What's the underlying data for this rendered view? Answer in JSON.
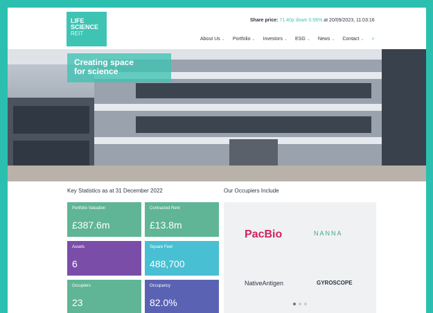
{
  "logo": {
    "line1": "LIFE",
    "line2": "SCIENCE",
    "line3": "REIT"
  },
  "header": {
    "share_label": "Share price:",
    "share_price": "71.40p down 0.56%",
    "share_time": "at 20/09/2023, 11:03:16",
    "nav": [
      {
        "label": "About Us"
      },
      {
        "label": "Portfolio"
      },
      {
        "label": "Investors"
      },
      {
        "label": "ESG"
      },
      {
        "label": "News"
      },
      {
        "label": "Contact"
      }
    ]
  },
  "hero": {
    "line1": "Creating space",
    "line2": "for science"
  },
  "stats": {
    "title": "Key Statistics as at 31 December 2022",
    "tiles": [
      {
        "label": "Portfolio Valuation",
        "value": "£387.6m",
        "color": "#5fb596"
      },
      {
        "label": "Contracted Rent",
        "value": "£13.8m",
        "color": "#5fb596"
      },
      {
        "label": "Assets",
        "value": "6",
        "color": "#7a4ea8"
      },
      {
        "label": "Square Feet",
        "value": "488,700",
        "color": "#48bfd3"
      },
      {
        "label": "Occupiers",
        "value": "23",
        "color": "#5fb596"
      },
      {
        "label": "Occupancy",
        "value": "82.0%",
        "color": "#5a63b3"
      }
    ]
  },
  "occupiers": {
    "title": "Our Occupiers Include",
    "logos": [
      "PacBio",
      "NANNA",
      "NativeAntigen",
      "GYROSCOPE"
    ]
  },
  "colors": {
    "accent": "#3fc3b3",
    "text": "#2c3440"
  }
}
